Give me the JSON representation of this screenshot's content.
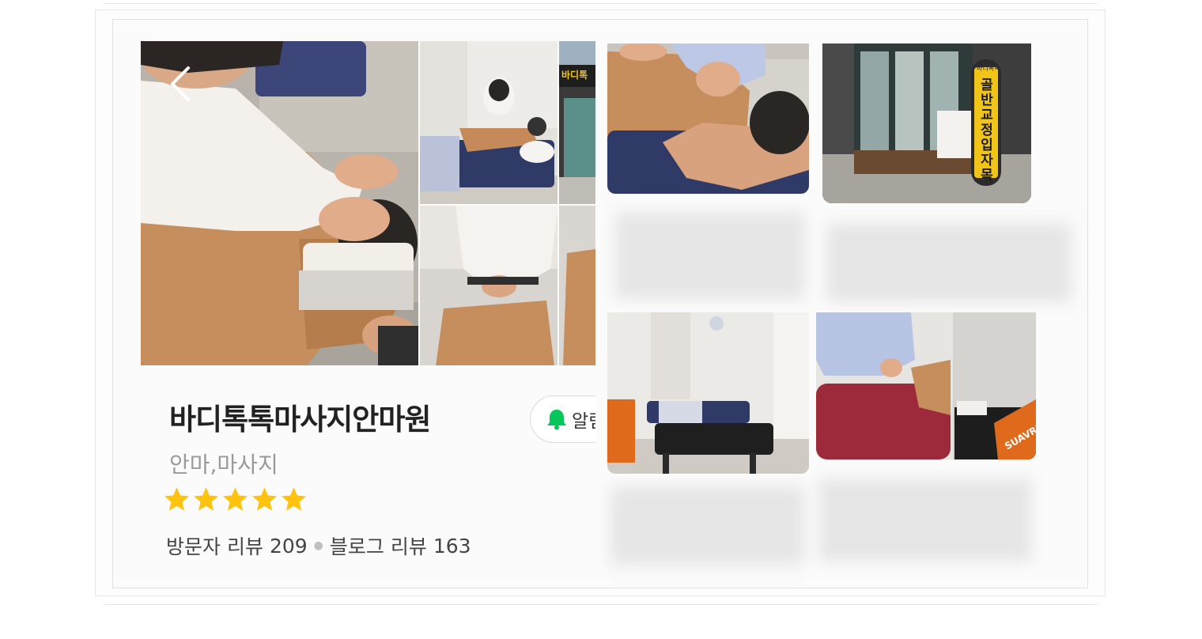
{
  "place": {
    "name": "바디톡톡마사지안마원",
    "category": "안마,마사지",
    "rating_stars": 5,
    "visitor_review_label": "방문자 리뷰",
    "visitor_review_count": "209",
    "blog_review_label": "블로그 리뷰",
    "blog_review_count": "163"
  },
  "alarm": {
    "label": "알림"
  },
  "storefront_pillar": {
    "top_text": "바디톡톡",
    "main_text": "골반교정입자목"
  },
  "table_brand_text": "SUAVRE",
  "sign_text": "바디톡",
  "colors": {
    "accent_green": "#03c75a",
    "star_yellow": "#ffc20e",
    "shirt_tan": "#c8895a",
    "table_navy": "#2f3a66",
    "towel_red": "#9c2a3a",
    "pillar_yellow": "#f0c419"
  },
  "icons": [
    "back-chevron-icon",
    "bell-icon",
    "star-icon"
  ]
}
